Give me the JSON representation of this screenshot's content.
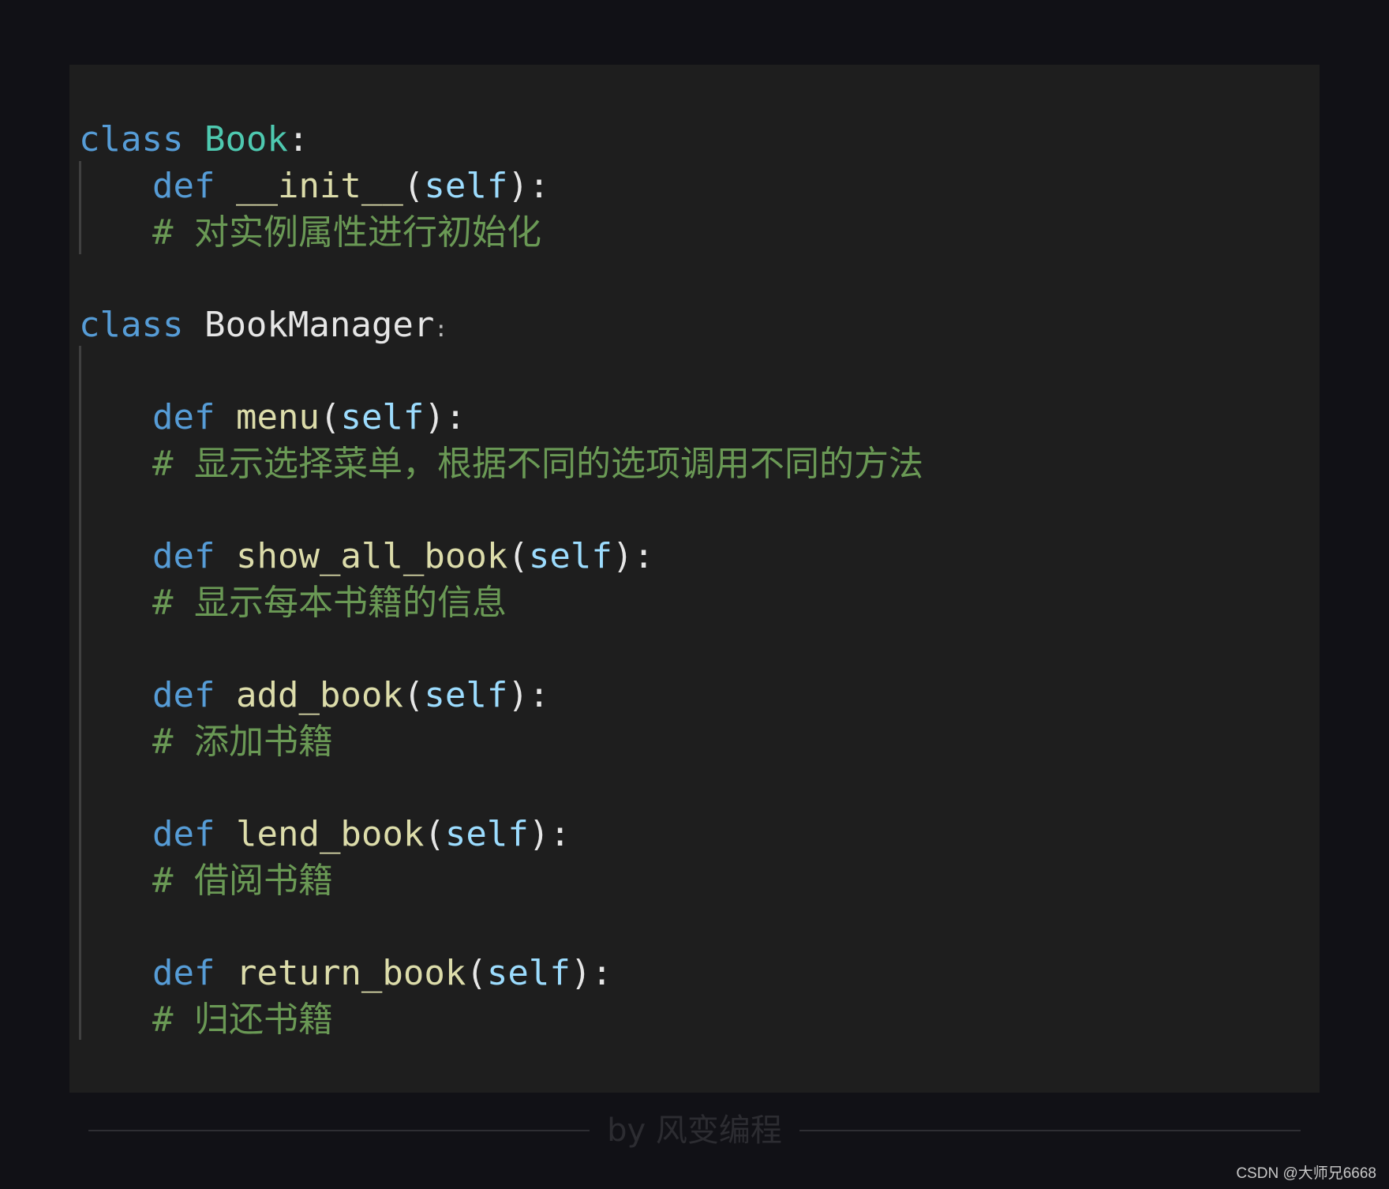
{
  "code": {
    "book_class": {
      "kw_class": "class",
      "name": "Book",
      "colon": ":",
      "init": {
        "kw_def": "def",
        "name": "__init__",
        "open": "(",
        "param": "self",
        "close": "):",
        "comment": "# 对实例属性进行初始化"
      }
    },
    "manager_class": {
      "kw_class": "class",
      "name": "BookManager",
      "colon": ":",
      "methods": [
        {
          "kw_def": "def",
          "name": "menu",
          "open": "(",
          "param": "self",
          "close": "):",
          "comment": "# 显示选择菜单，根据不同的选项调用不同的方法"
        },
        {
          "kw_def": "def",
          "name": "show_all_book",
          "open": "(",
          "param": "self",
          "close": "):",
          "comment": "# 显示每本书籍的信息"
        },
        {
          "kw_def": "def",
          "name": "add_book",
          "open": "(",
          "param": "self",
          "close": "):",
          "comment": "# 添加书籍"
        },
        {
          "kw_def": "def",
          "name": "lend_book",
          "open": "(",
          "param": "self",
          "close": "):",
          "comment": "# 借阅书籍"
        },
        {
          "kw_def": "def",
          "name": "return_book",
          "open": "(",
          "param": "self",
          "close": "):",
          "comment": "# 归还书籍"
        }
      ]
    }
  },
  "footer": {
    "credit": "by 风变编程"
  },
  "watermark": "CSDN @大师兄6668",
  "colors": {
    "page_bg": "#111116",
    "editor_bg": "#1e1e1e",
    "keyword": "#569cd6",
    "class_name": "#4ec9b0",
    "function": "#dcdcaa",
    "parameter": "#9cdcfe",
    "comment": "#6a9955"
  }
}
